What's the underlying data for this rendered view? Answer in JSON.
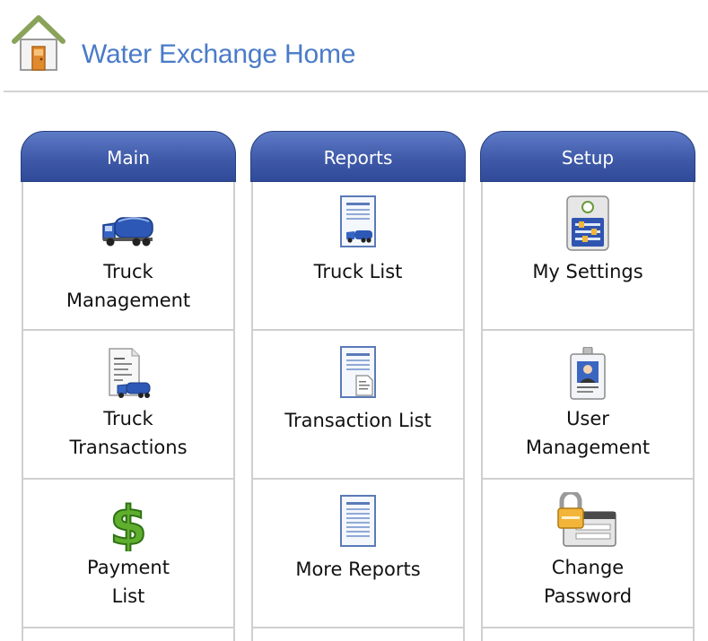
{
  "app": {
    "title": "Water Exchange Home"
  },
  "panels": [
    {
      "title": "Main",
      "items": [
        {
          "line1": "Truck",
          "line2": "Management"
        },
        {
          "line1": "Truck",
          "line2": "Transactions"
        },
        {
          "line1": "Payment",
          "line2": "List"
        }
      ]
    },
    {
      "title": "Reports",
      "items": [
        {
          "line1": "Truck List"
        },
        {
          "line1": "Transaction List"
        },
        {
          "line1": "More Reports"
        }
      ]
    },
    {
      "title": "Setup",
      "items": [
        {
          "line1": "My Settings"
        },
        {
          "line1": "User",
          "line2": "Management"
        },
        {
          "line1": "Change",
          "line2": "Password"
        }
      ]
    }
  ],
  "colors": {
    "title": "#4a7bc8",
    "panel_header": "#3f5aa8",
    "divider": "#cfcfcf"
  },
  "icons": [
    "home-icon",
    "truck-icon",
    "truck-transaction-icon",
    "dollar-icon",
    "truck-list-icon",
    "transaction-list-icon",
    "report-icon",
    "settings-icon",
    "user-badge-icon",
    "change-password-icon"
  ]
}
